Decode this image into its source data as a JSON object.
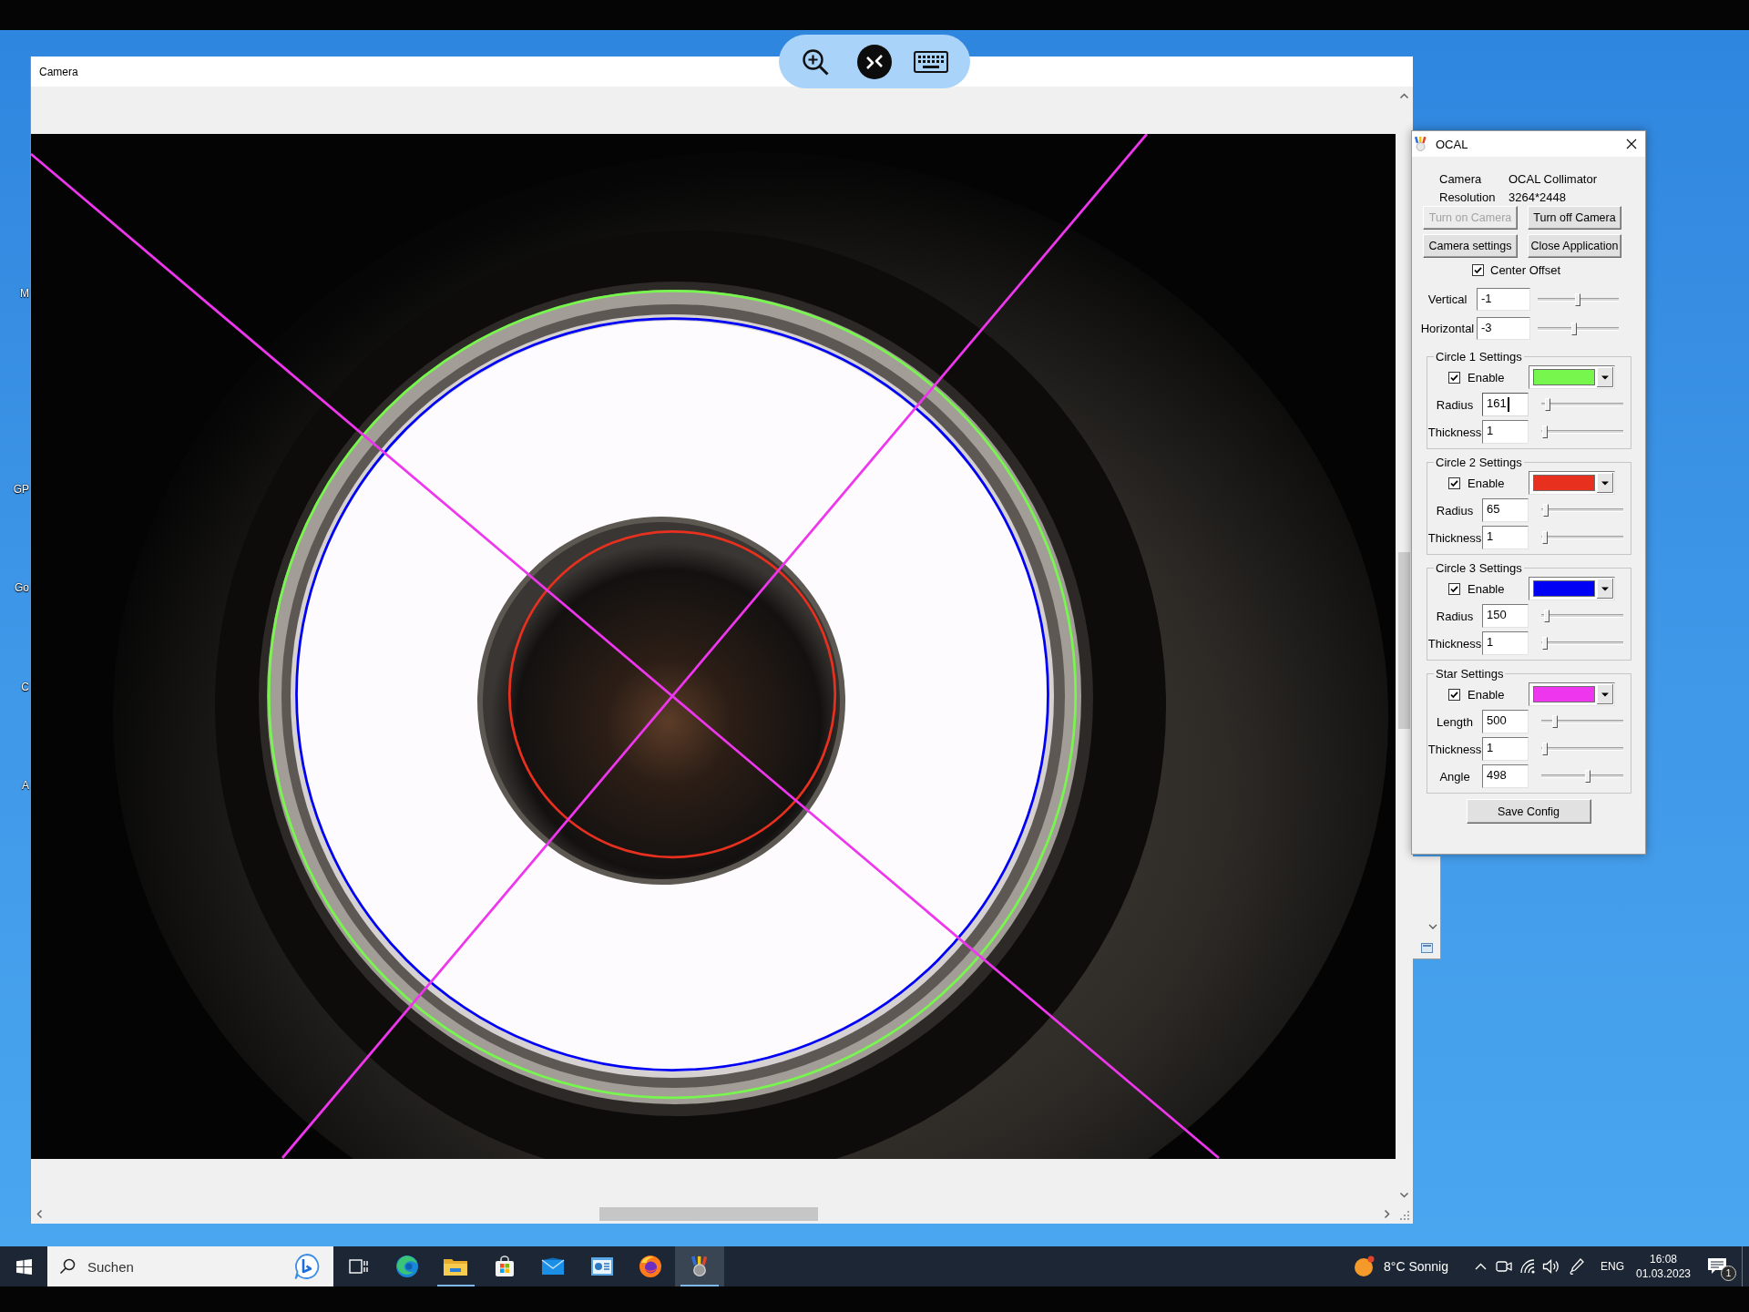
{
  "desktop": {
    "icon_labels": [
      "M",
      "GP",
      "Go",
      "C",
      "A"
    ]
  },
  "camera_window": {
    "title": "Camera"
  },
  "ocal_window": {
    "title": "OCAL",
    "info": [
      {
        "label": "Camera",
        "value": "OCAL Collimator"
      },
      {
        "label": "Resolution",
        "value": "3264*2448"
      }
    ],
    "buttons": [
      {
        "label": "Turn on Camera",
        "disabled": true
      },
      {
        "label": "Turn off Camera",
        "disabled": false
      },
      {
        "label": "Camera settings",
        "disabled": false
      },
      {
        "label": "Close Application",
        "disabled": false
      }
    ],
    "center_offset": {
      "label": "Center Offset",
      "checked": true
    },
    "offsets": [
      {
        "label": "Vertical",
        "value": "-1",
        "focused": false,
        "level": 0.49
      },
      {
        "label": "Horizontal",
        "value": "-3",
        "focused": false,
        "level": 0.45
      }
    ],
    "groups": [
      {
        "kind": "circle",
        "title": "Circle 1 Settings",
        "enable_label": "Enable",
        "enabled": true,
        "color": "#77f74d",
        "fields": [
          {
            "label": "Radius",
            "value": "161",
            "focused": true,
            "level": 0.08
          },
          {
            "label": "Thickness",
            "value": "1",
            "focused": false,
            "level": 0.04
          }
        ]
      },
      {
        "kind": "circle",
        "title": "Circle 2 Settings",
        "enable_label": "Enable",
        "enabled": true,
        "color": "#e8301f",
        "fields": [
          {
            "label": "Radius",
            "value": "65",
            "focused": false,
            "level": 0.06
          },
          {
            "label": "Thickness",
            "value": "1",
            "focused": false,
            "level": 0.04
          }
        ]
      },
      {
        "kind": "circle",
        "title": "Circle 3 Settings",
        "enable_label": "Enable",
        "enabled": true,
        "color": "#0000f5",
        "fields": [
          {
            "label": "Radius",
            "value": "150",
            "focused": false,
            "level": 0.07
          },
          {
            "label": "Thickness",
            "value": "1",
            "focused": false,
            "level": 0.04
          }
        ]
      },
      {
        "kind": "star",
        "title": "Star Settings",
        "enable_label": "Enable",
        "enabled": true,
        "color": "#ee36ee",
        "fields": [
          {
            "label": "Length",
            "value": "500",
            "focused": false,
            "level": 0.17
          },
          {
            "label": "Thickness",
            "value": "1",
            "focused": false,
            "level": 0.04
          },
          {
            "label": "Angle",
            "value": "498",
            "focused": false,
            "level": 0.57
          }
        ]
      }
    ],
    "save_button": "Save Config"
  },
  "taskbar": {
    "search": {
      "placeholder": "Suchen"
    },
    "apps": [
      {
        "running": false,
        "active": false
      },
      {
        "running": true,
        "active": false
      },
      {
        "running": false,
        "active": false
      },
      {
        "running": false,
        "active": false
      },
      {
        "running": false,
        "active": false
      },
      {
        "running": false,
        "active": false
      },
      {
        "running": true,
        "active": true
      }
    ],
    "weather": "8°C Sonnig",
    "language": "ENG",
    "time": "16:08",
    "date": "01.03.2023",
    "notification_count": "1"
  }
}
